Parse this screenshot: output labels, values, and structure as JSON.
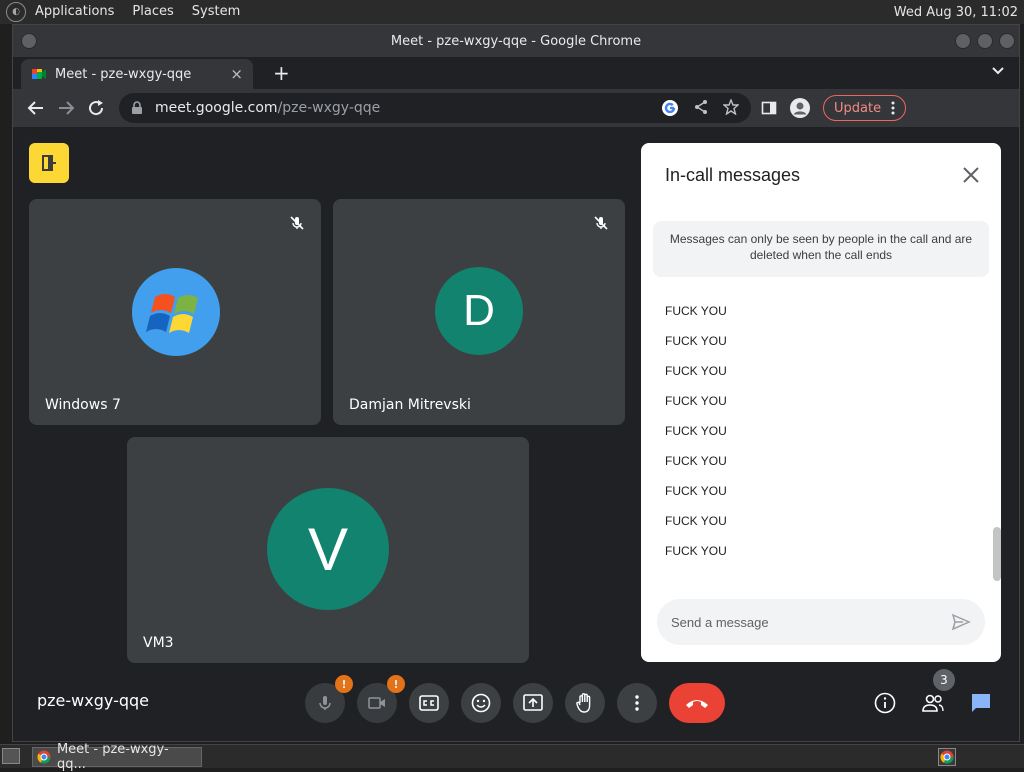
{
  "top_panel": {
    "menus": [
      "Applications",
      "Places",
      "System"
    ],
    "clock": "Wed Aug 30, 11:02"
  },
  "window": {
    "title": "Meet - pze-wxgy-qqe - Google Chrome"
  },
  "tab": {
    "title": "Meet - pze-wxgy-qqe",
    "close_glyph": "×",
    "new_tab_glyph": "+"
  },
  "toolbar": {
    "url_host": "meet.google.com",
    "url_path": "/pze-wxgy-qqe",
    "update_label": "Update"
  },
  "participants": [
    {
      "name": "Windows 7",
      "avatar_type": "windows-logo"
    },
    {
      "name": "Damjan Mitrevski",
      "avatar_letter": "D"
    },
    {
      "name": "VM3",
      "avatar_letter": "V"
    }
  ],
  "chat": {
    "title": "In-call messages",
    "notice": "Messages can only be seen by people in the call and are deleted when the call ends",
    "messages": [
      "FUCK YOU",
      "FUCK YOU",
      "FUCK YOU",
      "FUCK YOU",
      "FUCK YOU",
      "FUCK YOU",
      "FUCK YOU",
      "FUCK YOU",
      "FUCK YOU"
    ],
    "input_placeholder": "Send a message"
  },
  "bottom_bar": {
    "meeting_code": "pze-wxgy-qqe",
    "people_count": "3",
    "warn_glyph": "!"
  },
  "taskbar": {
    "task_label": "Meet - pze-wxgy-qq..."
  },
  "colors": {
    "avatar_bg": "#12836f",
    "end_call": "#ea4335",
    "meet_logo": "#fdd835",
    "warning": "#fa7b17",
    "chat_icon": "#8ab4f8"
  }
}
